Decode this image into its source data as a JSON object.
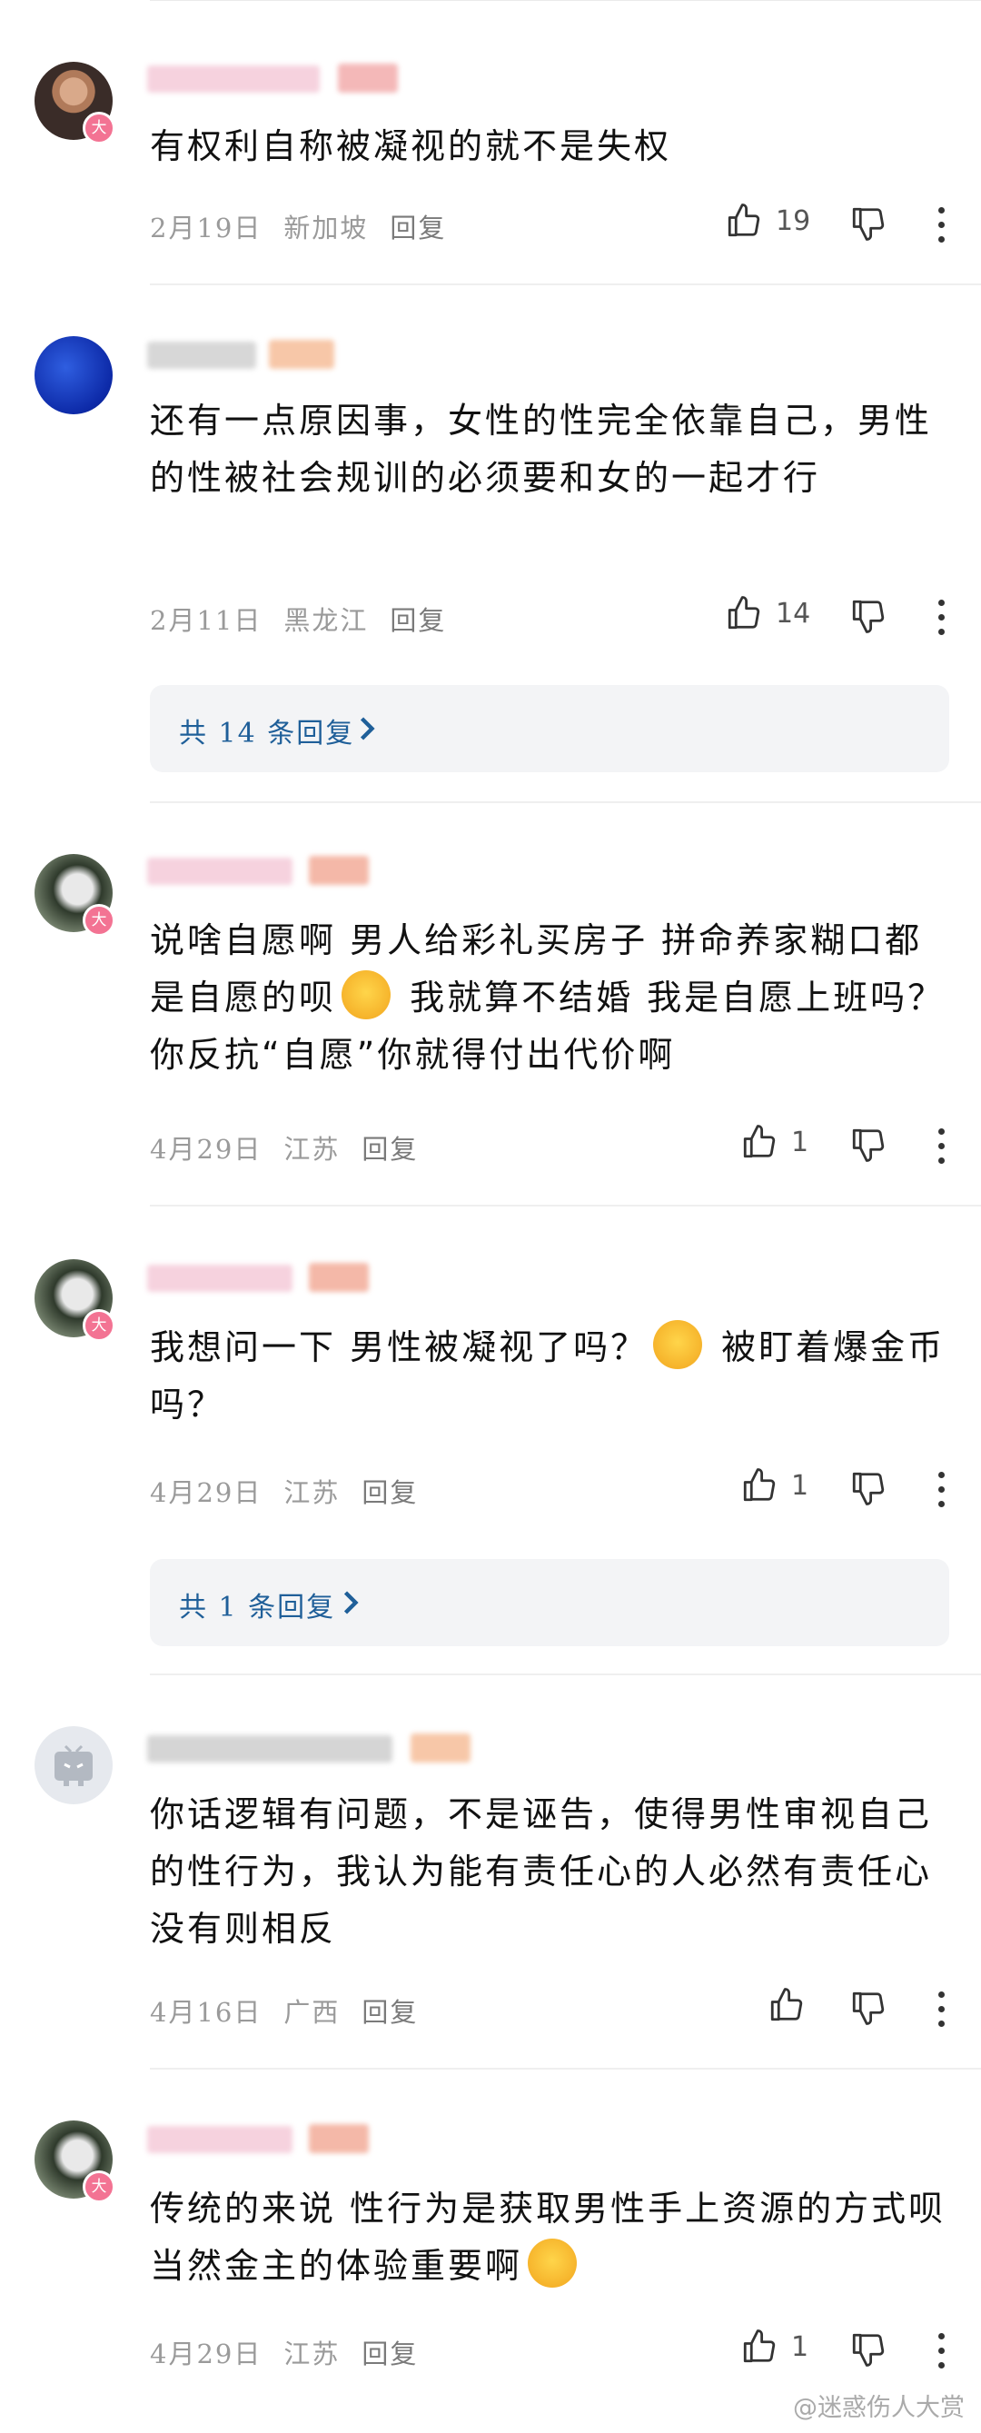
{
  "comments": [
    {
      "text": "有权利自称被凝视的就不是失权",
      "date": "2月19日",
      "location": "新加坡",
      "reply": "回复",
      "likes": "19",
      "avatar": "avatar-man",
      "badge": "大"
    },
    {
      "text": "还有一点原因事，女性的性完全依靠自己，男性的性被社会规训的必须要和女的一起才行",
      "date": "2月11日",
      "location": "黑龙江",
      "reply": "回复",
      "likes": "14",
      "avatar": "avatar-blue",
      "badge": "",
      "replies_label": "共 14 条回复"
    },
    {
      "text_a": "说啥自愿啊 男人给彩礼买房子 拼命养家糊口都是自愿的呗",
      "emoji": "yawning-face-emoji",
      "text_b": " 我就算不结婚 我是自愿上班吗？ 你反抗“自愿”你就得付出代价啊",
      "date": "4月29日",
      "location": "江苏",
      "reply": "回复",
      "likes": "1",
      "badge": "大"
    },
    {
      "text_a": "我想问一下 男性被凝视了吗？",
      "emoji": "grinning-squint-emoji",
      "text_b": " 被盯着爆金币吗？",
      "date": "4月29日",
      "location": "江苏",
      "reply": "回复",
      "likes": "1",
      "badge": "大",
      "replies_label": "共 1 条回复"
    },
    {
      "text": "你话逻辑有问题，不是诬告，使得男性审视自己的性行为，我认为能有责任心的人必然有责任心没有则相反",
      "date": "4月16日",
      "location": "广西",
      "reply": "回复",
      "likes": "",
      "badge": ""
    },
    {
      "text_a": "传统的来说 性行为是获取男性手上资源的方式呗 当然金主的体验重要啊",
      "emoji": "grinning-squint-emoji",
      "date": "4月29日",
      "location": "江苏",
      "reply": "回复",
      "likes": "1",
      "badge": "大"
    }
  ],
  "watermark": "@迷惑伤人大赏",
  "colors": {
    "badge": "#f37393",
    "link": "#1f5f99",
    "meta": "#9a9a9a"
  }
}
